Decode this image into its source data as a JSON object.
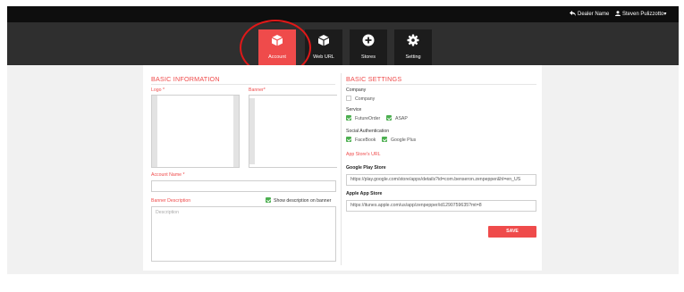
{
  "topbar": {
    "dealer_link": "Dealer Name",
    "user_menu": "Steven Pulizzotto"
  },
  "nav": {
    "tiles": [
      {
        "label": "Account",
        "icon": "cube-icon",
        "active": true
      },
      {
        "label": "Web URL",
        "icon": "cube-icon",
        "active": false
      },
      {
        "label": "Stores",
        "icon": "plus-circle-icon",
        "active": false
      },
      {
        "label": "Setting",
        "icon": "gear-icon",
        "active": false
      }
    ]
  },
  "basic_info": {
    "heading": "BASIC INFORMATION",
    "logo_label": "Logo *",
    "banner_label": "Banner*",
    "account_name_label": "Account Name *",
    "account_name_value": "",
    "banner_desc_label": "Banner Description",
    "show_desc_label": "Show description on banner",
    "show_desc_checked": true,
    "description_placeholder": "Description"
  },
  "basic_settings": {
    "heading": "BASIC SETTINGS",
    "company_label": "Company",
    "company_option": "Company",
    "company_checked": false,
    "service_label": "Service",
    "service_futureorder": "FutureOrder",
    "service_asap": "ASAP",
    "social_label": "Social Authentication",
    "social_facebook": "FaceBook",
    "social_google": "Google Plus",
    "app_store_url_label": "App Store's URL",
    "google_play_label": "Google Play Store",
    "google_play_value": "https://play.google.com/store/apps/details?id=com.benseron.zenpepper&hl=en_US",
    "apple_label": "Apple App Store",
    "apple_value": "https://itunes.apple.com/us/app/zenpepper/id1290759635?mt=8"
  },
  "save_label": "SAVE",
  "colors": {
    "accent": "#ef4b4b",
    "check": "#4caf50",
    "topbar": "#0e0e0e",
    "iconbar": "#2f2f2f",
    "annotation": "#e01818"
  }
}
